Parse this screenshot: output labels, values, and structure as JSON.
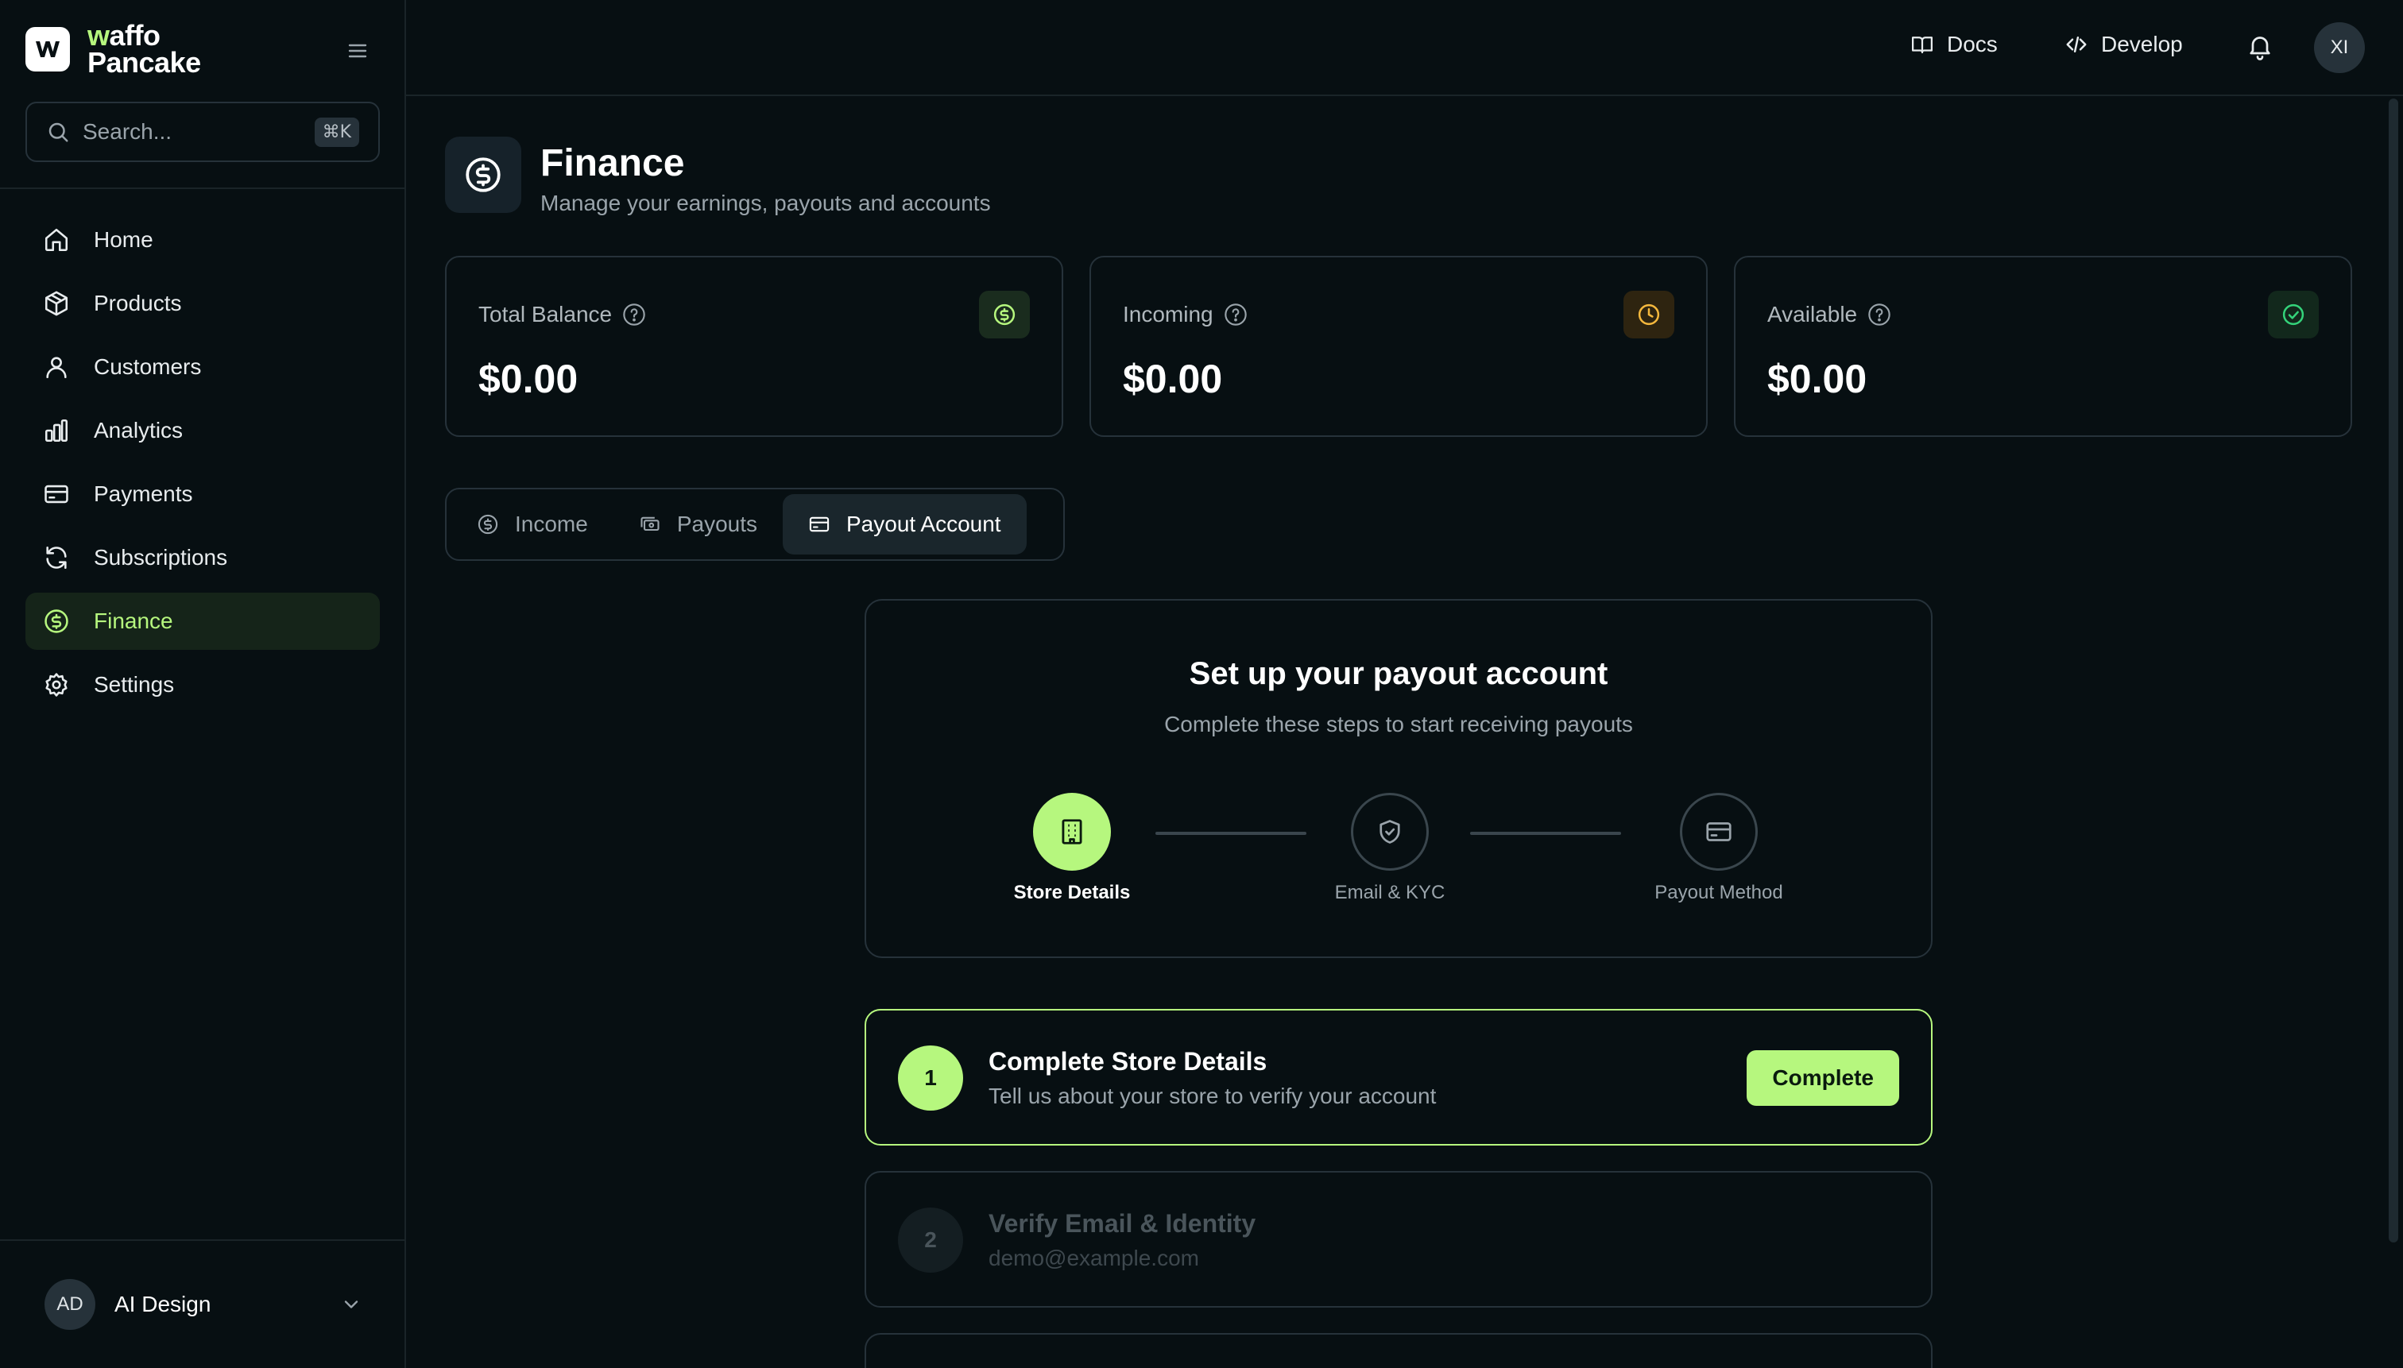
{
  "brand": {
    "line1_accent": "w",
    "line1_rest": "affo",
    "line2": "Pancake",
    "accent_color": "#b6f77e"
  },
  "search": {
    "placeholder": "Search...",
    "shortcut": "⌘K"
  },
  "sidebar": {
    "items": [
      {
        "label": "Home",
        "icon": "home-icon"
      },
      {
        "label": "Products",
        "icon": "box-icon"
      },
      {
        "label": "Customers",
        "icon": "user-icon"
      },
      {
        "label": "Analytics",
        "icon": "bar-chart-icon"
      },
      {
        "label": "Payments",
        "icon": "credit-card-icon"
      },
      {
        "label": "Subscriptions",
        "icon": "refresh-icon"
      },
      {
        "label": "Finance",
        "icon": "dollar-circle-icon",
        "active": true
      },
      {
        "label": "Settings",
        "icon": "gear-icon"
      }
    ],
    "user": {
      "initials": "AD",
      "name": "AI Design"
    }
  },
  "header": {
    "docs_label": "Docs",
    "develop_label": "Develop",
    "avatar_initials": "XI"
  },
  "page": {
    "title": "Finance",
    "subtitle": "Manage your earnings, payouts and accounts"
  },
  "stats": [
    {
      "label": "Total Balance",
      "value": "$0.00",
      "icon": "dollar-circle-icon",
      "color": "#b6f77e"
    },
    {
      "label": "Incoming",
      "value": "$0.00",
      "icon": "clock-icon",
      "color": "#f5b83d"
    },
    {
      "label": "Available",
      "value": "$0.00",
      "icon": "check-circle-icon",
      "color": "#34d37a"
    }
  ],
  "tabs": [
    {
      "label": "Income",
      "icon": "dollar-circle-icon"
    },
    {
      "label": "Payouts",
      "icon": "banknote-icon"
    },
    {
      "label": "Payout Account",
      "icon": "credit-card-icon",
      "active": true
    }
  ],
  "setup": {
    "title": "Set up your payout account",
    "subtitle": "Complete these steps to start receiving payouts",
    "steps": [
      {
        "label": "Store Details",
        "icon": "building-icon",
        "active": true
      },
      {
        "label": "Email & KYC",
        "icon": "shield-check-icon",
        "active": false
      },
      {
        "label": "Payout Method",
        "icon": "credit-card-icon",
        "active": false
      }
    ]
  },
  "tasks": [
    {
      "number": "1",
      "title": "Complete Store Details",
      "description": "Tell us about your store to verify your account",
      "button": "Complete"
    },
    {
      "number": "2",
      "title": "Verify Email & Identity",
      "description": "demo@example.com"
    }
  ]
}
